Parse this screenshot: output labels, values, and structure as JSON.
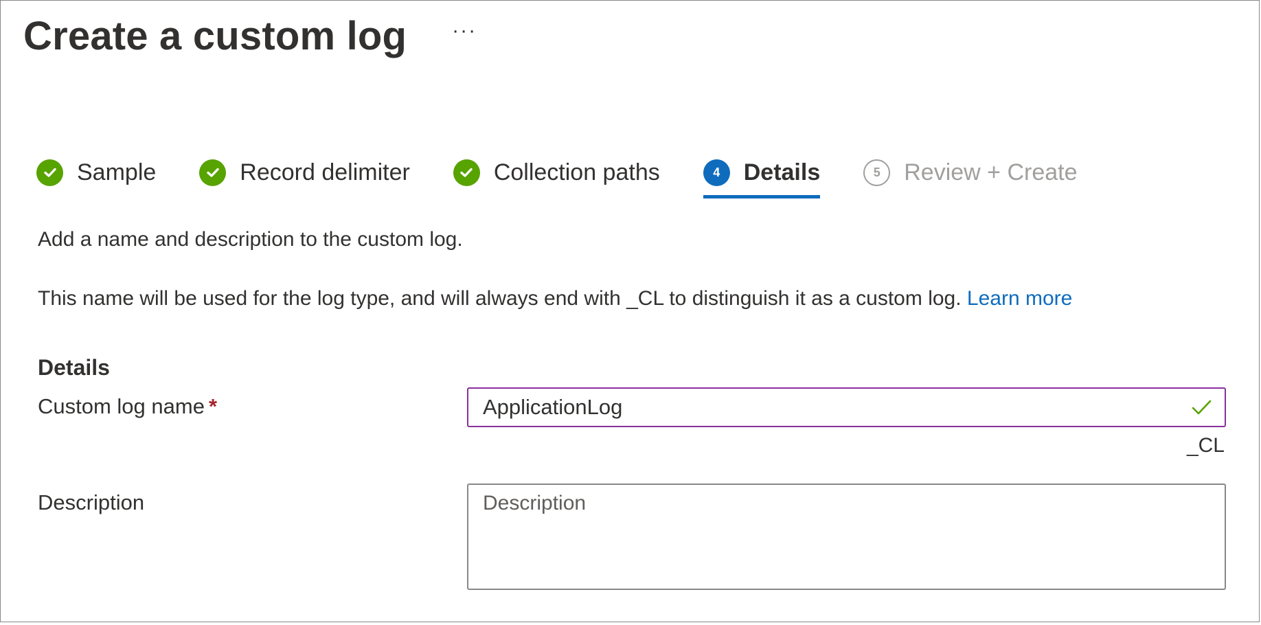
{
  "header": {
    "title": "Create a custom log",
    "more_label": "···"
  },
  "steps": [
    {
      "label": "Sample",
      "state": "done",
      "icon": "check-circle-icon"
    },
    {
      "label": "Record delimiter",
      "state": "done",
      "icon": "check-circle-icon"
    },
    {
      "label": "Collection paths",
      "state": "done",
      "icon": "check-circle-icon"
    },
    {
      "label": "Details",
      "state": "current",
      "number": "4"
    },
    {
      "label": "Review + Create",
      "state": "todo",
      "number": "5"
    }
  ],
  "content": {
    "intro": "Add a name and description to the custom log.",
    "description": "This name will be used for the log type, and will always end with _CL to distinguish it as a custom log.",
    "learn_more": "Learn more"
  },
  "form": {
    "section_title": "Details",
    "name_label": "Custom log name",
    "required_marker": "*",
    "name_value": "ApplicationLog",
    "name_suffix": "_CL",
    "description_label": "Description",
    "description_placeholder": "Description",
    "description_value": ""
  },
  "colors": {
    "accent": "#0f6cbd",
    "success": "#57a300",
    "focus_border": "#8a2f9e",
    "required": "#a4262c"
  }
}
